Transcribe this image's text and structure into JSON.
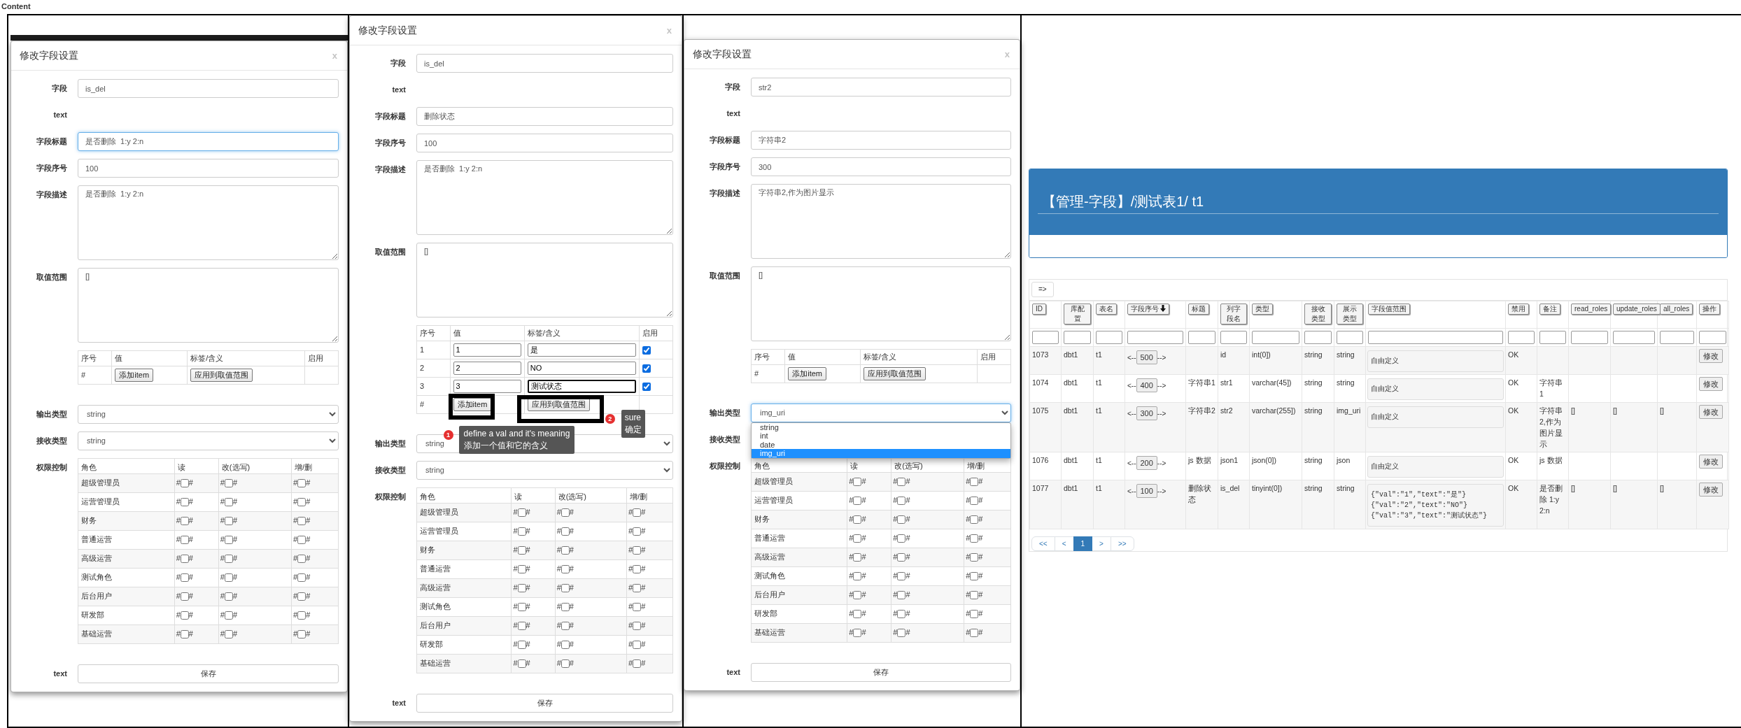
{
  "page_label": "Content",
  "dialogs": [
    {
      "title": "修改字段设置",
      "close": "x",
      "fields": [
        {
          "label": "字段",
          "kind": "input",
          "value": "is_del",
          "focused": false
        },
        {
          "label": "text",
          "kind": "static"
        },
        {
          "label": "字段标题",
          "kind": "input",
          "value": "是否删除  1:y 2:n",
          "focused": true
        },
        {
          "label": "字段序号",
          "kind": "input",
          "value": "100",
          "focused": false
        },
        {
          "label": "字段描述",
          "kind": "textarea",
          "value": "是否删除  1:y 2:n",
          "focused": false
        },
        {
          "label": "取值范围",
          "kind": "textarea",
          "value": "[]",
          "focused": false
        }
      ],
      "value_table": {
        "columns": [
          "序号",
          "值",
          "标签/含义",
          "启用"
        ],
        "add_row_label": "#",
        "add_button": {
          "label": "添加item"
        },
        "apply_button": {
          "label": "应用到取值范围"
        }
      },
      "type_fields": [
        {
          "label": "输出类型",
          "kind": "select",
          "value": "string",
          "focused": false
        },
        {
          "label": "接收类型",
          "kind": "select",
          "value": "string",
          "focused": false
        }
      ],
      "permissions": {
        "label": "权限控制",
        "columns": [
          "角色",
          "读",
          "改(选写)",
          "增/删"
        ],
        "rows": [
          {
            "cells": [
              {
                "kind": "role",
                "text": "超级管理员"
              },
              {
                "kind": "permission",
                "before": "#",
                "checked": false,
                "after": "#"
              },
              {
                "kind": "permission",
                "before": "#",
                "checked": false,
                "after": "#"
              },
              {
                "kind": "permission",
                "before": "#",
                "checked": false,
                "after": "#"
              }
            ]
          },
          {
            "cells": [
              {
                "kind": "role",
                "text": "运营管理员"
              },
              {
                "kind": "permission",
                "before": "#",
                "checked": false,
                "after": "#"
              },
              {
                "kind": "permission",
                "before": "#",
                "checked": false,
                "after": "#"
              },
              {
                "kind": "permission",
                "before": "#",
                "checked": false,
                "after": "#"
              }
            ]
          },
          {
            "cells": [
              {
                "kind": "role",
                "text": "财务"
              },
              {
                "kind": "permission",
                "before": "#",
                "checked": false,
                "after": "#"
              },
              {
                "kind": "permission",
                "before": "#",
                "checked": false,
                "after": "#"
              },
              {
                "kind": "permission",
                "before": "#",
                "checked": false,
                "after": "#"
              }
            ]
          },
          {
            "cells": [
              {
                "kind": "role",
                "text": "普通运营"
              },
              {
                "kind": "permission",
                "before": "#",
                "checked": false,
                "after": "#"
              },
              {
                "kind": "permission",
                "before": "#",
                "checked": false,
                "after": "#"
              },
              {
                "kind": "permission",
                "before": "#",
                "checked": false,
                "after": "#"
              }
            ]
          },
          {
            "cells": [
              {
                "kind": "role",
                "text": "高级运营"
              },
              {
                "kind": "permission",
                "before": "#",
                "checked": false,
                "after": "#"
              },
              {
                "kind": "permission",
                "before": "#",
                "checked": false,
                "after": "#"
              },
              {
                "kind": "permission",
                "before": "#",
                "checked": false,
                "after": "#"
              }
            ]
          },
          {
            "cells": [
              {
                "kind": "role",
                "text": "测试角色"
              },
              {
                "kind": "permission",
                "before": "#",
                "checked": false,
                "after": "#"
              },
              {
                "kind": "permission",
                "before": "#",
                "checked": false,
                "after": "#"
              },
              {
                "kind": "permission",
                "before": "#",
                "checked": false,
                "after": "#"
              }
            ]
          },
          {
            "cells": [
              {
                "kind": "role",
                "text": "后台用户"
              },
              {
                "kind": "permission",
                "before": "#",
                "checked": false,
                "after": "#"
              },
              {
                "kind": "permission",
                "before": "#",
                "checked": false,
                "after": "#"
              },
              {
                "kind": "permission",
                "before": "#",
                "checked": false,
                "after": "#"
              }
            ]
          },
          {
            "cells": [
              {
                "kind": "role",
                "text": "研发部"
              },
              {
                "kind": "permission",
                "before": "#",
                "checked": false,
                "after": "#"
              },
              {
                "kind": "permission",
                "before": "#",
                "checked": false,
                "after": "#"
              },
              {
                "kind": "permission",
                "before": "#",
                "checked": false,
                "after": "#"
              }
            ]
          },
          {
            "cells": [
              {
                "kind": "role",
                "text": "基础运营"
              },
              {
                "kind": "permission",
                "before": "#",
                "checked": false,
                "after": "#"
              },
              {
                "kind": "permission",
                "before": "#",
                "checked": false,
                "after": "#"
              },
              {
                "kind": "permission",
                "before": "#",
                "checked": false,
                "after": "#"
              }
            ]
          }
        ]
      },
      "footer": {
        "label": "text",
        "button": "保存"
      }
    },
    {
      "title": "修改字段设置",
      "close": "x",
      "fields": [
        {
          "label": "字段",
          "kind": "input",
          "value": "is_del",
          "focused": false
        },
        {
          "label": "text",
          "kind": "static"
        },
        {
          "label": "字段标题",
          "kind": "input",
          "value": "删除状态",
          "focused": false
        },
        {
          "label": "字段序号",
          "kind": "input",
          "value": "100",
          "focused": false
        },
        {
          "label": "字段描述",
          "kind": "textarea",
          "value": "是否删除  1:y 2:n",
          "focused": false
        },
        {
          "label": "取值范围",
          "kind": "textarea",
          "value": "[]",
          "focused": false
        }
      ],
      "value_table": {
        "columns": [
          "序号",
          "值",
          "标签/含义",
          "启用"
        ],
        "rows": [
          {
            "index": "1",
            "value": "1",
            "label": "是",
            "enabled": true,
            "focused": false
          },
          {
            "index": "2",
            "value": "2",
            "label": "NO",
            "enabled": true,
            "focused": false
          },
          {
            "index": "3",
            "value": "3",
            "label": "测试状态",
            "enabled": true,
            "focused": true
          }
        ],
        "add_row_label": "#",
        "add_button": {
          "label": "添加item",
          "callout": {
            "number": "1",
            "lines": [
              "define a val and it's meaning",
              "添加一个值和它的含义"
            ]
          }
        },
        "apply_button": {
          "label": "应用到取值范围",
          "callout": {
            "number": "2",
            "lines": [
              "sure",
              "确定"
            ]
          }
        }
      },
      "type_fields": [
        {
          "label": "输出类型",
          "kind": "select",
          "value": "string",
          "focused": false
        },
        {
          "label": "接收类型",
          "kind": "select",
          "value": "string",
          "focused": false
        }
      ],
      "permissions": {
        "label": "权限控制",
        "columns": [
          "角色",
          "读",
          "改(选写)",
          "增/删"
        ],
        "rows": [
          {
            "cells": [
              {
                "kind": "role",
                "text": "超级管理员"
              },
              {
                "kind": "permission",
                "before": "#",
                "checked": false,
                "after": "#"
              },
              {
                "kind": "permission",
                "before": "#",
                "checked": false,
                "after": "#"
              },
              {
                "kind": "permission",
                "before": "#",
                "checked": false,
                "after": "#"
              }
            ]
          },
          {
            "cells": [
              {
                "kind": "role",
                "text": "运营管理员"
              },
              {
                "kind": "permission",
                "before": "#",
                "checked": false,
                "after": "#"
              },
              {
                "kind": "permission",
                "before": "#",
                "checked": false,
                "after": "#"
              },
              {
                "kind": "permission",
                "before": "#",
                "checked": false,
                "after": "#"
              }
            ]
          },
          {
            "cells": [
              {
                "kind": "role",
                "text": "财务"
              },
              {
                "kind": "permission",
                "before": "#",
                "checked": false,
                "after": "#"
              },
              {
                "kind": "permission",
                "before": "#",
                "checked": false,
                "after": "#"
              },
              {
                "kind": "permission",
                "before": "#",
                "checked": false,
                "after": "#"
              }
            ]
          },
          {
            "cells": [
              {
                "kind": "role",
                "text": "普通运营"
              },
              {
                "kind": "permission",
                "before": "#",
                "checked": false,
                "after": "#"
              },
              {
                "kind": "permission",
                "before": "#",
                "checked": false,
                "after": "#"
              },
              {
                "kind": "permission",
                "before": "#",
                "checked": false,
                "after": "#"
              }
            ]
          },
          {
            "cells": [
              {
                "kind": "role",
                "text": "高级运营"
              },
              {
                "kind": "permission",
                "before": "#",
                "checked": false,
                "after": "#"
              },
              {
                "kind": "permission",
                "before": "#",
                "checked": false,
                "after": "#"
              },
              {
                "kind": "permission",
                "before": "#",
                "checked": false,
                "after": "#"
              }
            ]
          },
          {
            "cells": [
              {
                "kind": "role",
                "text": "测试角色"
              },
              {
                "kind": "permission",
                "before": "#",
                "checked": false,
                "after": "#"
              },
              {
                "kind": "permission",
                "before": "#",
                "checked": false,
                "after": "#"
              },
              {
                "kind": "permission",
                "before": "#",
                "checked": false,
                "after": "#"
              }
            ]
          },
          {
            "cells": [
              {
                "kind": "role",
                "text": "后台用户"
              },
              {
                "kind": "permission",
                "before": "#",
                "checked": false,
                "after": "#"
              },
              {
                "kind": "permission",
                "before": "#",
                "checked": false,
                "after": "#"
              },
              {
                "kind": "permission",
                "before": "#",
                "checked": false,
                "after": "#"
              }
            ]
          },
          {
            "cells": [
              {
                "kind": "role",
                "text": "研发部"
              },
              {
                "kind": "permission",
                "before": "#",
                "checked": false,
                "after": "#"
              },
              {
                "kind": "permission",
                "before": "#",
                "checked": false,
                "after": "#"
              },
              {
                "kind": "permission",
                "before": "#",
                "checked": false,
                "after": "#"
              }
            ]
          },
          {
            "cells": [
              {
                "kind": "role",
                "text": "基础运营"
              },
              {
                "kind": "permission",
                "before": "#",
                "checked": false,
                "after": "#"
              },
              {
                "kind": "permission",
                "before": "#",
                "checked": false,
                "after": "#"
              },
              {
                "kind": "permission",
                "before": "#",
                "checked": false,
                "after": "#"
              }
            ]
          }
        ]
      },
      "footer": {
        "label": "text",
        "button": "保存"
      }
    },
    {
      "title": "修改字段设置",
      "close": "x",
      "fields": [
        {
          "label": "字段",
          "kind": "input",
          "value": "str2",
          "focused": false
        },
        {
          "label": "text",
          "kind": "static"
        },
        {
          "label": "字段标题",
          "kind": "input",
          "value": "字符串2",
          "focused": false
        },
        {
          "label": "字段序号",
          "kind": "input",
          "value": "300",
          "focused": false
        },
        {
          "label": "字段描述",
          "kind": "textarea",
          "value": "字符串2,作为图片显示",
          "focused": false
        },
        {
          "label": "取值范围",
          "kind": "textarea",
          "value": "[]",
          "focused": false
        }
      ],
      "value_table": {
        "columns": [
          "序号",
          "值",
          "标签/含义",
          "启用"
        ],
        "add_row_label": "#",
        "add_button": {
          "label": "添加item"
        },
        "apply_button": {
          "label": "应用到取值范围"
        }
      },
      "type_fields": [
        {
          "label": "输出类型",
          "kind": "select",
          "value": "img_uri",
          "focused": true,
          "options": [
            {
              "label": "string",
              "selected": false
            },
            {
              "label": "int",
              "selected": false
            },
            {
              "label": "date",
              "selected": false
            },
            {
              "label": "img_uri",
              "selected": true
            }
          ]
        },
        {
          "label": "接收类型",
          "kind": "select"
        }
      ],
      "permissions": {
        "label": "权限控制",
        "columns": [
          "角色",
          "读",
          "改(选写)",
          "增/删"
        ],
        "rows": [
          {
            "cells": [
              {
                "kind": "role",
                "text": "超级管理员"
              },
              {
                "kind": "permission",
                "before": "#",
                "checked": false,
                "after": "#"
              },
              {
                "kind": "permission",
                "before": "#",
                "checked": false,
                "after": "#"
              },
              {
                "kind": "permission",
                "before": "#",
                "checked": false,
                "after": "#"
              }
            ]
          },
          {
            "cells": [
              {
                "kind": "role",
                "text": "运营管理员"
              },
              {
                "kind": "permission",
                "before": "#",
                "checked": false,
                "after": "#"
              },
              {
                "kind": "permission",
                "before": "#",
                "checked": false,
                "after": "#"
              },
              {
                "kind": "permission",
                "before": "#",
                "checked": false,
                "after": "#"
              }
            ]
          },
          {
            "cells": [
              {
                "kind": "role",
                "text": "财务"
              },
              {
                "kind": "permission",
                "before": "#",
                "checked": false,
                "after": "#"
              },
              {
                "kind": "permission",
                "before": "#",
                "checked": false,
                "after": "#"
              },
              {
                "kind": "permission",
                "before": "#",
                "checked": false,
                "after": "#"
              }
            ]
          },
          {
            "cells": [
              {
                "kind": "role",
                "text": "普通运营"
              },
              {
                "kind": "permission",
                "before": "#",
                "checked": false,
                "after": "#"
              },
              {
                "kind": "permission",
                "before": "#",
                "checked": false,
                "after": "#"
              },
              {
                "kind": "permission",
                "before": "#",
                "checked": false,
                "after": "#"
              }
            ]
          },
          {
            "cells": [
              {
                "kind": "role",
                "text": "高级运营"
              },
              {
                "kind": "permission",
                "before": "#",
                "checked": false,
                "after": "#"
              },
              {
                "kind": "permission",
                "before": "#",
                "checked": false,
                "after": "#"
              },
              {
                "kind": "permission",
                "before": "#",
                "checked": false,
                "after": "#"
              }
            ]
          },
          {
            "cells": [
              {
                "kind": "role",
                "text": "测试角色"
              },
              {
                "kind": "permission",
                "before": "#",
                "checked": false,
                "after": "#"
              },
              {
                "kind": "permission",
                "before": "#",
                "checked": false,
                "after": "#"
              },
              {
                "kind": "permission",
                "before": "#",
                "checked": false,
                "after": "#"
              }
            ]
          },
          {
            "cells": [
              {
                "kind": "role",
                "text": "后台用户"
              },
              {
                "kind": "permission",
                "before": "#",
                "checked": false,
                "after": "#"
              },
              {
                "kind": "permission",
                "before": "#",
                "checked": false,
                "after": "#"
              },
              {
                "kind": "permission",
                "before": "#",
                "checked": false,
                "after": "#"
              }
            ]
          },
          {
            "cells": [
              {
                "kind": "role",
                "text": "研发部"
              },
              {
                "kind": "permission",
                "before": "#",
                "checked": false,
                "after": "#"
              },
              {
                "kind": "permission",
                "before": "#",
                "checked": false,
                "after": "#"
              },
              {
                "kind": "permission",
                "before": "#",
                "checked": false,
                "after": "#"
              }
            ]
          },
          {
            "cells": [
              {
                "kind": "role",
                "text": "基础运营"
              },
              {
                "kind": "permission",
                "before": "#",
                "checked": false,
                "after": "#"
              },
              {
                "kind": "permission",
                "before": "#",
                "checked": false,
                "after": "#"
              },
              {
                "kind": "permission",
                "before": "#",
                "checked": false,
                "after": "#"
              }
            ]
          }
        ]
      },
      "footer": {
        "label": "text",
        "button": "保存"
      }
    }
  ],
  "field_list": {
    "title": "【管理-字段】/测试表1/ t1",
    "toolbar_button": "=>",
    "columns": [
      {
        "label": "ID",
        "sorted": false
      },
      {
        "label": "库配置",
        "sorted": false
      },
      {
        "label": "表名",
        "sorted": false
      },
      {
        "label": "字段序号",
        "sorted": true
      },
      {
        "label": "标题",
        "sorted": false
      },
      {
        "label": "列字段名",
        "sorted": false
      },
      {
        "label": "类型",
        "sorted": false
      },
      {
        "label": "接收类型",
        "sorted": false
      },
      {
        "label": "展示类型",
        "sorted": false
      },
      {
        "label": "字段值范围",
        "sorted": false
      },
      {
        "label": "禁用",
        "sorted": false
      },
      {
        "label": "备注",
        "sorted": false
      },
      {
        "label": "read_roles",
        "sorted": false
      },
      {
        "label": "update_roles",
        "sorted": false
      },
      {
        "label": "all_roles",
        "sorted": false
      },
      {
        "label": "操作",
        "sorted": false
      }
    ],
    "rows": [
      {
        "id": "1073",
        "db": "dbt1",
        "table": "t1",
        "order": {
          "prev": "<--",
          "value": "500",
          "next": "-->"
        },
        "column": "id",
        "type": "int(0])",
        "receive": "string",
        "display": "string",
        "range": [
          "自由定义"
        ],
        "status": "OK",
        "action": "修改"
      },
      {
        "id": "1074",
        "db": "dbt1",
        "table": "t1",
        "order": {
          "prev": "<--",
          "value": "400",
          "next": "-->"
        },
        "title": "字符串1",
        "column": "str1",
        "type": "varchar(45])",
        "receive": "string",
        "display": "string",
        "range": [
          "自由定义"
        ],
        "status": "OK",
        "note": "字符串1",
        "action": "修改"
      },
      {
        "id": "1075",
        "db": "dbt1",
        "table": "t1",
        "order": {
          "prev": "<--",
          "value": "300",
          "next": "-->"
        },
        "title": "字符串2",
        "column": "str2",
        "type": "varchar(255])",
        "receive": "string",
        "display": "img_uri",
        "range": [
          "自由定义"
        ],
        "status": "OK",
        "note": "字符串2,作为图片显示",
        "read_roles": "[]",
        "update_roles": "[]",
        "all_roles": "[]",
        "action": "修改"
      },
      {
        "id": "1076",
        "db": "dbt1",
        "table": "t1",
        "order": {
          "prev": "<--",
          "value": "200",
          "next": "-->"
        },
        "title": "js 数据",
        "column": "json1",
        "type": "json(0])",
        "receive": "string",
        "display": "json",
        "range": [
          "自由定义"
        ],
        "status": "OK",
        "note": "js 数据",
        "action": "修改"
      },
      {
        "id": "1077",
        "db": "dbt1",
        "table": "t1",
        "order": {
          "prev": "<--",
          "value": "100",
          "next": "-->"
        },
        "title": "删除状态",
        "column": "is_del",
        "type": "tinyint(0])",
        "receive": "string",
        "display": "string",
        "range": [
          "{\"val\":\"1\",\"text\":\"是\"}",
          "{\"val\":\"2\",\"text\":\"NO\"}",
          "{\"val\":\"3\",\"text\":\"测试状态\"}"
        ],
        "status": "OK",
        "note": "是否删除 1:y 2:n",
        "read_roles": "[]",
        "update_roles": "[]",
        "all_roles": "[]",
        "action": "修改"
      }
    ],
    "pagination": [
      {
        "label": "<<",
        "selected": false
      },
      {
        "label": "<",
        "selected": false
      },
      {
        "label": "1",
        "selected": true
      },
      {
        "label": ">",
        "selected": false
      },
      {
        "label": ">>",
        "selected": false
      }
    ]
  }
}
